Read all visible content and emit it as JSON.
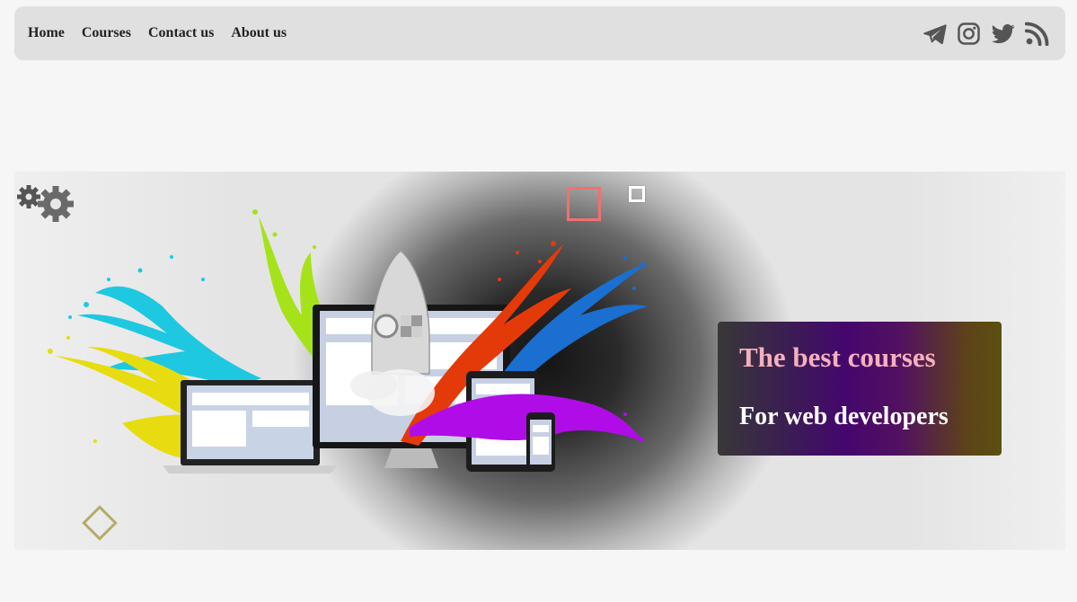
{
  "nav": {
    "links": [
      {
        "label": "Home"
      },
      {
        "label": "Courses"
      },
      {
        "label": "Contact us"
      },
      {
        "label": "About us"
      }
    ],
    "social_icons": [
      "telegram-icon",
      "instagram-icon",
      "twitter-icon",
      "rss-icon"
    ]
  },
  "hero": {
    "title": "The best courses",
    "subtitle": "For web developers",
    "colors": {
      "title": "#f4b0bc",
      "subtitle": "#ffffff",
      "deco_square": "#f07070",
      "deco_diamond": "#b3ac6a",
      "splash_colors": [
        "#1ec8e0",
        "#a6e21a",
        "#e43a0a",
        "#1a6fd0",
        "#e6dc10",
        "#b00ce8"
      ]
    },
    "illustration": "rocket-launching-from-devices-with-paint-splashes",
    "decorations": [
      "gears-icon",
      "square-outline-red",
      "square-outline-white",
      "diamond-outline-olive"
    ]
  },
  "theme": {
    "background": "#f6f6f6",
    "navbar_background": "#e0e0e0",
    "icon_color": "#555555"
  }
}
